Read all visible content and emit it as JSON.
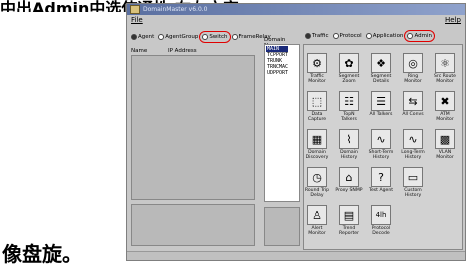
{
  "banner": "中出Admin中选使通性 在左方窗",
  "caption": "像盘旋。",
  "window": {
    "title": "DomainMaster v6.0.0",
    "menu_file": "File",
    "menu_help": "Help"
  },
  "left_radios": [
    {
      "label": "Agent",
      "selected": true
    },
    {
      "label": "AgentGroup",
      "selected": false
    },
    {
      "label": "Switch",
      "selected": false,
      "circled": true
    },
    {
      "label": "FrameRelay",
      "selected": false
    }
  ],
  "left_columns": [
    "Name",
    "IP Address"
  ],
  "domain_panel": {
    "header": "Domain Name",
    "items": [
      "MAIN",
      "TCPPORT",
      "TRUNK",
      "TRNCMAC",
      "UDPPORT"
    ],
    "selected_index": 0
  },
  "right_radios": [
    {
      "label": "Traffic",
      "selected": true
    },
    {
      "label": "Protocol",
      "selected": false
    },
    {
      "label": "Application",
      "selected": false
    },
    {
      "label": "Admin",
      "selected": false,
      "circled": true
    }
  ],
  "tools": [
    [
      {
        "label": "Traffic Monitor",
        "icon": "traffic-monitor-icon",
        "glyph": "⚙"
      },
      {
        "label": "Segment Zoom",
        "icon": "segment-zoom-icon",
        "glyph": "✿"
      },
      {
        "label": "Segment Details",
        "icon": "segment-details-icon",
        "glyph": "❖"
      },
      {
        "label": "Ring Monitor",
        "icon": "ring-monitor-icon",
        "glyph": "◎"
      },
      {
        "label": "Src Route Monitor",
        "icon": "src-route-monitor-icon",
        "glyph": "⚛"
      }
    ],
    [
      {
        "label": "Data Capture",
        "icon": "data-capture-icon",
        "glyph": "⬚"
      },
      {
        "label": "TopN Talkers",
        "icon": "topn-talkers-icon",
        "glyph": "☷"
      },
      {
        "label": "All Talkers",
        "icon": "all-talkers-icon",
        "glyph": "☰"
      },
      {
        "label": "All Convs",
        "icon": "all-convs-icon",
        "glyph": "⇆"
      },
      {
        "label": "ATM Monitor",
        "icon": "atm-monitor-icon",
        "glyph": "✖"
      }
    ],
    [
      {
        "label": "Domain Discovery",
        "icon": "domain-discovery-icon",
        "glyph": "▦"
      },
      {
        "label": "Domain History",
        "icon": "domain-history-icon",
        "glyph": "⌇"
      },
      {
        "label": "Short-Term History",
        "icon": "short-term-history-icon",
        "glyph": "∿"
      },
      {
        "label": "Long-Term History",
        "icon": "long-term-history-icon",
        "glyph": "∿"
      },
      {
        "label": "VLAN Monitor",
        "icon": "vlan-monitor-icon",
        "glyph": "▩"
      }
    ],
    [
      {
        "label": "Round Trip Delay",
        "icon": "round-trip-delay-icon",
        "glyph": "◷"
      },
      {
        "label": "Proxy SNMP",
        "icon": "proxy-snmp-icon",
        "glyph": "⌂"
      },
      {
        "label": "Test Agent",
        "icon": "test-agent-icon",
        "glyph": "?"
      },
      {
        "label": "Custom History",
        "icon": "custom-history-icon",
        "glyph": "▭"
      }
    ],
    [
      {
        "label": "Alert Monitor",
        "icon": "alert-monitor-icon",
        "glyph": "♙"
      },
      {
        "label": "Trend Reporter",
        "icon": "trend-reporter-icon",
        "glyph": "▤"
      },
      {
        "label": "Protocol Decode",
        "icon": "protocol-decode-icon",
        "glyph": "4lh"
      }
    ]
  ]
}
